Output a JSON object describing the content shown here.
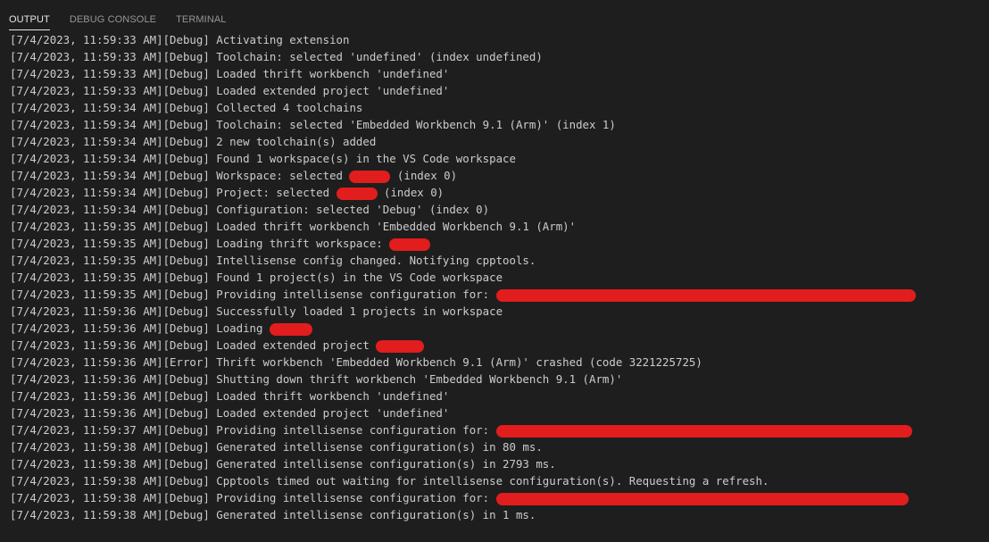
{
  "tabs": {
    "output": "OUTPUT",
    "debug_console": "DEBUG CONSOLE",
    "terminal": "TERMINAL"
  },
  "colors": {
    "background": "#1e1e1e",
    "text": "#cccccc",
    "active_tab": "#e7e7e7",
    "inactive_tab": "#969696",
    "redaction": "#e11d1d"
  },
  "log": [
    {
      "text": "[7/4/2023, 11:59:33 AM][Debug] Activating extension",
      "redact_after": "",
      "tail": ""
    },
    {
      "text": "[7/4/2023, 11:59:33 AM][Debug] Toolchain: selected 'undefined' (index undefined)",
      "redact_after": "",
      "tail": ""
    },
    {
      "text": "[7/4/2023, 11:59:33 AM][Debug] Loaded thrift workbench 'undefined'",
      "redact_after": "",
      "tail": ""
    },
    {
      "text": "[7/4/2023, 11:59:33 AM][Debug] Loaded extended project 'undefined'",
      "redact_after": "",
      "tail": ""
    },
    {
      "text": "[7/4/2023, 11:59:34 AM][Debug] Collected 4 toolchains",
      "redact_after": "",
      "tail": ""
    },
    {
      "text": "[7/4/2023, 11:59:34 AM][Debug] Toolchain: selected 'Embedded Workbench 9.1 (Arm)' (index 1)",
      "redact_after": "",
      "tail": ""
    },
    {
      "text": "[7/4/2023, 11:59:34 AM][Debug] 2 new toolchain(s) added",
      "redact_after": "",
      "tail": ""
    },
    {
      "text": "[7/4/2023, 11:59:34 AM][Debug] Found 1 workspace(s) in the VS Code workspace",
      "redact_after": "",
      "tail": ""
    },
    {
      "text": "[7/4/2023, 11:59:34 AM][Debug] Workspace: selected",
      "redact_after": "yes",
      "tail": " (index 0)"
    },
    {
      "text": "[7/4/2023, 11:59:34 AM][Debug] Project: selected",
      "redact_after": "yes",
      "tail": " (index 0)"
    },
    {
      "text": "[7/4/2023, 11:59:34 AM][Debug] Configuration: selected 'Debug' (index 0)",
      "redact_after": "",
      "tail": ""
    },
    {
      "text": "[7/4/2023, 11:59:35 AM][Debug] Loaded thrift workbench 'Embedded Workbench 9.1 (Arm)'",
      "redact_after": "",
      "tail": ""
    },
    {
      "text": "[7/4/2023, 11:59:35 AM][Debug] Loading thrift workspace:",
      "redact_after": "yes",
      "tail": ""
    },
    {
      "text": "[7/4/2023, 11:59:35 AM][Debug] Intellisense config changed. Notifying cpptools.",
      "redact_after": "",
      "tail": ""
    },
    {
      "text": "[7/4/2023, 11:59:35 AM][Debug] Found 1 project(s) in the VS Code workspace",
      "redact_after": "",
      "tail": ""
    },
    {
      "text": "[7/4/2023, 11:59:35 AM][Debug] Providing intellisense configuration for:",
      "redact_after": "long",
      "tail": ""
    },
    {
      "text": "[7/4/2023, 11:59:36 AM][Debug] Successfully loaded 1 projects in workspace",
      "redact_after": "",
      "tail": ""
    },
    {
      "text": "[7/4/2023, 11:59:36 AM][Debug] Loading",
      "redact_after": "yes",
      "tail": ""
    },
    {
      "text": "[7/4/2023, 11:59:36 AM][Debug] Loaded extended project",
      "redact_after": "yes",
      "tail": ""
    },
    {
      "text": "[7/4/2023, 11:59:36 AM][Error] Thrift workbench 'Embedded Workbench 9.1 (Arm)' crashed (code 3221225725)",
      "redact_after": "",
      "tail": ""
    },
    {
      "text": "[7/4/2023, 11:59:36 AM][Debug] Shutting down thrift workbench 'Embedded Workbench 9.1 (Arm)'",
      "redact_after": "",
      "tail": ""
    },
    {
      "text": "[7/4/2023, 11:59:36 AM][Debug] Loaded thrift workbench 'undefined'",
      "redact_after": "",
      "tail": ""
    },
    {
      "text": "[7/4/2023, 11:59:36 AM][Debug] Loaded extended project 'undefined'",
      "redact_after": "",
      "tail": ""
    },
    {
      "text": "[7/4/2023, 11:59:37 AM][Debug] Providing intellisense configuration for:",
      "redact_after": "long",
      "tail": ""
    },
    {
      "text": "[7/4/2023, 11:59:38 AM][Debug] Generated intellisense configuration(s) in 80 ms.",
      "redact_after": "",
      "tail": ""
    },
    {
      "text": "[7/4/2023, 11:59:38 AM][Debug] Generated intellisense configuration(s) in 2793 ms.",
      "redact_after": "",
      "tail": ""
    },
    {
      "text": "[7/4/2023, 11:59:38 AM][Debug] Cpptools timed out waiting for intellisense configuration(s). Requesting a refresh.",
      "redact_after": "",
      "tail": ""
    },
    {
      "text": "[7/4/2023, 11:59:38 AM][Debug] Providing intellisense configuration for:",
      "redact_after": "long",
      "tail": ""
    },
    {
      "text": "[7/4/2023, 11:59:38 AM][Debug] Generated intellisense configuration(s) in 1 ms.",
      "redact_after": "",
      "tail": ""
    }
  ]
}
